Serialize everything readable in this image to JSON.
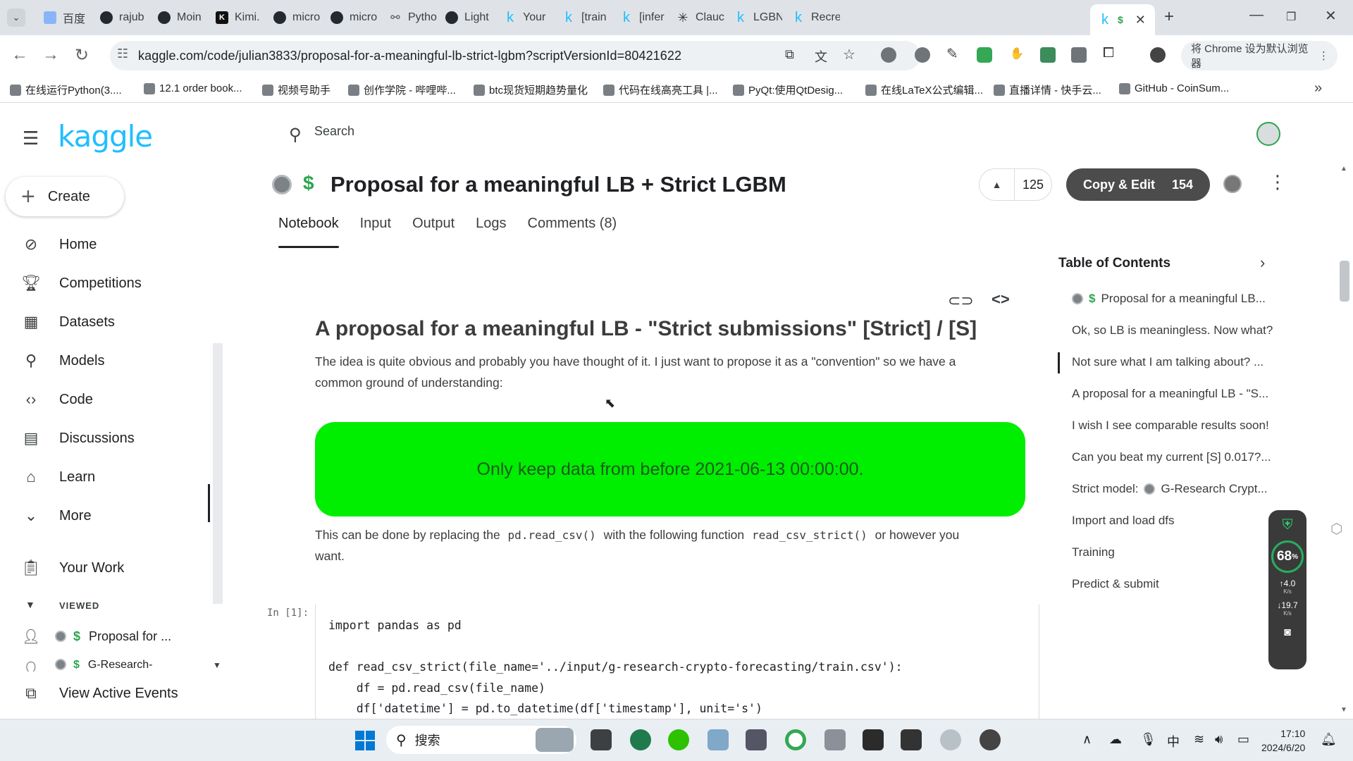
{
  "browser": {
    "tabs": [
      {
        "label": "百度",
        "icon": "baidu-icon"
      },
      {
        "label": "rajub",
        "icon": "github-icon"
      },
      {
        "label": "Moin",
        "icon": "github-icon"
      },
      {
        "label": "Kimi.",
        "icon": "kimi-icon"
      },
      {
        "label": "micro",
        "icon": "github-icon"
      },
      {
        "label": "micro",
        "icon": "github-icon"
      },
      {
        "label": "Pytho",
        "icon": "python-icon"
      },
      {
        "label": "Light",
        "icon": "github-icon"
      },
      {
        "label": "Your",
        "icon": "kaggle-icon"
      },
      {
        "label": "[train",
        "icon": "kaggle-icon"
      },
      {
        "label": "[infer",
        "icon": "kaggle-icon"
      },
      {
        "label": "Clauc",
        "icon": "claude-icon"
      },
      {
        "label": "LGBN",
        "icon": "kaggle-icon"
      },
      {
        "label": "Recre",
        "icon": "kaggle-icon"
      },
      {
        "label": "$",
        "icon": "kaggle-icon"
      }
    ],
    "active_tab_label": "$",
    "url": "kaggle.com/code/julian3833/proposal-for-a-meaningful-lb-strict-lgbm?scriptVersionId=80421622",
    "default_browser_prompt": "将 Chrome 设为默认浏览器",
    "bookmarks": [
      "在线运行Python(3....",
      "12.1 order book...",
      "视频号助手",
      "创作学院 - 哔哩哔...",
      "btc现货短期趋势量化",
      "代码在线高亮工具 |...",
      "PyQt:使用QtDesig...",
      "在线LaTeX公式编辑...",
      "直播详情 - 快手云...",
      "GitHub - CoinSum..."
    ]
  },
  "sidebar": {
    "logo": "kaggle",
    "create_label": "Create",
    "items": [
      {
        "label": "Home",
        "icon": "compass-icon"
      },
      {
        "label": "Competitions",
        "icon": "trophy-icon"
      },
      {
        "label": "Datasets",
        "icon": "table-icon"
      },
      {
        "label": "Models",
        "icon": "models-icon"
      },
      {
        "label": "Code",
        "icon": "code-icon"
      },
      {
        "label": "Discussions",
        "icon": "discussion-icon"
      },
      {
        "label": "Learn",
        "icon": "school-icon"
      },
      {
        "label": "More",
        "icon": "chevron-down-icon"
      }
    ],
    "your_work_label": "Your Work",
    "viewed_label": "VIEWED",
    "viewed_items": [
      "Proposal for ...",
      "G-Research-"
    ],
    "active_events_label": "View Active Events"
  },
  "search": {
    "placeholder": "Search"
  },
  "notebook": {
    "title": "Proposal for a meaningful LB + Strict LGBM",
    "votes": "125",
    "copy_edit_label": "Copy & Edit",
    "copy_edit_count": "154",
    "tabs": [
      "Notebook",
      "Input",
      "Output",
      "Logs",
      "Comments (8)"
    ],
    "active_tab": "Notebook",
    "heading": "A proposal for a meaningful LB - \"Strict submissions\" [Strict] / [S]",
    "intro_line1": "The idea is quite obvious and probably you have thought of it. I just want to propose it as a \"convention\" so we have a",
    "intro_line2": "common ground of understanding:",
    "highlight": "Only keep data from before 2021-06-13 00:00:00.",
    "replace_a": "This can be done by replacing the",
    "replace_code1": "pd.read_csv()",
    "replace_b": "with the following function",
    "replace_code2": "read_csv_strict()",
    "replace_c": "or however you",
    "replace_line2": "want.",
    "cell_prompt": "In [1]:",
    "code_lines": [
      "import pandas as pd",
      "",
      "def read_csv_strict(file_name='../input/g-research-crypto-forecasting/train.csv'):",
      "    df = pd.read_csv(file_name)",
      "    df['datetime'] = pd.to_datetime(df['timestamp'], unit='s')"
    ]
  },
  "toc": {
    "title": "Table of Contents",
    "items": [
      "Proposal for a meaningful LB...",
      "Ok, so LB is meaningless. Now what?",
      "Not sure what I am talking about? ...",
      "A proposal for a meaningful LB - \"S...",
      "I wish I see comparable results soon!",
      "Can you beat my current [S] 0.017?...",
      "Strict model:",
      "Import and load dfs",
      "Training",
      "Predict & submit"
    ],
    "strict_model_suffix": "G-Research Crypt..."
  },
  "net_widget": {
    "percent": "68",
    "percent_unit": "%",
    "up_rate": "4.0",
    "down_rate": "19.7",
    "unit": "K/s"
  },
  "taskbar": {
    "search_label": "搜索",
    "time": "17:10",
    "date": "2024/6/20",
    "ime": "中"
  }
}
